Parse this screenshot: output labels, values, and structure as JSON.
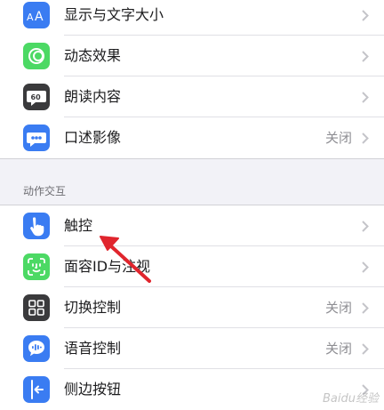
{
  "colors": {
    "background": "#f2f2f7",
    "cell": "#ffffff",
    "text": "#1c1c1e",
    "secondary": "#8e8e93",
    "blue": "#3a7cf2",
    "green": "#4cd964",
    "dark": "#3a3a3c",
    "arrow": "#e0252d"
  },
  "vision_group": {
    "items": [
      {
        "icon": "text-size-icon",
        "label": "显示与文字大小",
        "value": ""
      },
      {
        "icon": "motion-icon",
        "label": "动态效果",
        "value": ""
      },
      {
        "icon": "spoken-content-icon",
        "label": "朗读内容",
        "value": ""
      },
      {
        "icon": "audio-description-icon",
        "label": "口述影像",
        "value": "关闭"
      }
    ]
  },
  "interaction_section": {
    "header": "动作交互",
    "items": [
      {
        "icon": "touch-icon",
        "label": "触控",
        "value": ""
      },
      {
        "icon": "face-id-icon",
        "label": "面容ID与注视",
        "value": ""
      },
      {
        "icon": "switch-control-icon",
        "label": "切换控制",
        "value": "关闭"
      },
      {
        "icon": "voice-control-icon",
        "label": "语音控制",
        "value": "关闭"
      },
      {
        "icon": "side-button-icon",
        "label": "侧边按钮",
        "value": ""
      }
    ]
  },
  "annotation": {
    "icon": "red-arrow-icon",
    "target": "触控"
  },
  "watermark": "Baidu经验"
}
